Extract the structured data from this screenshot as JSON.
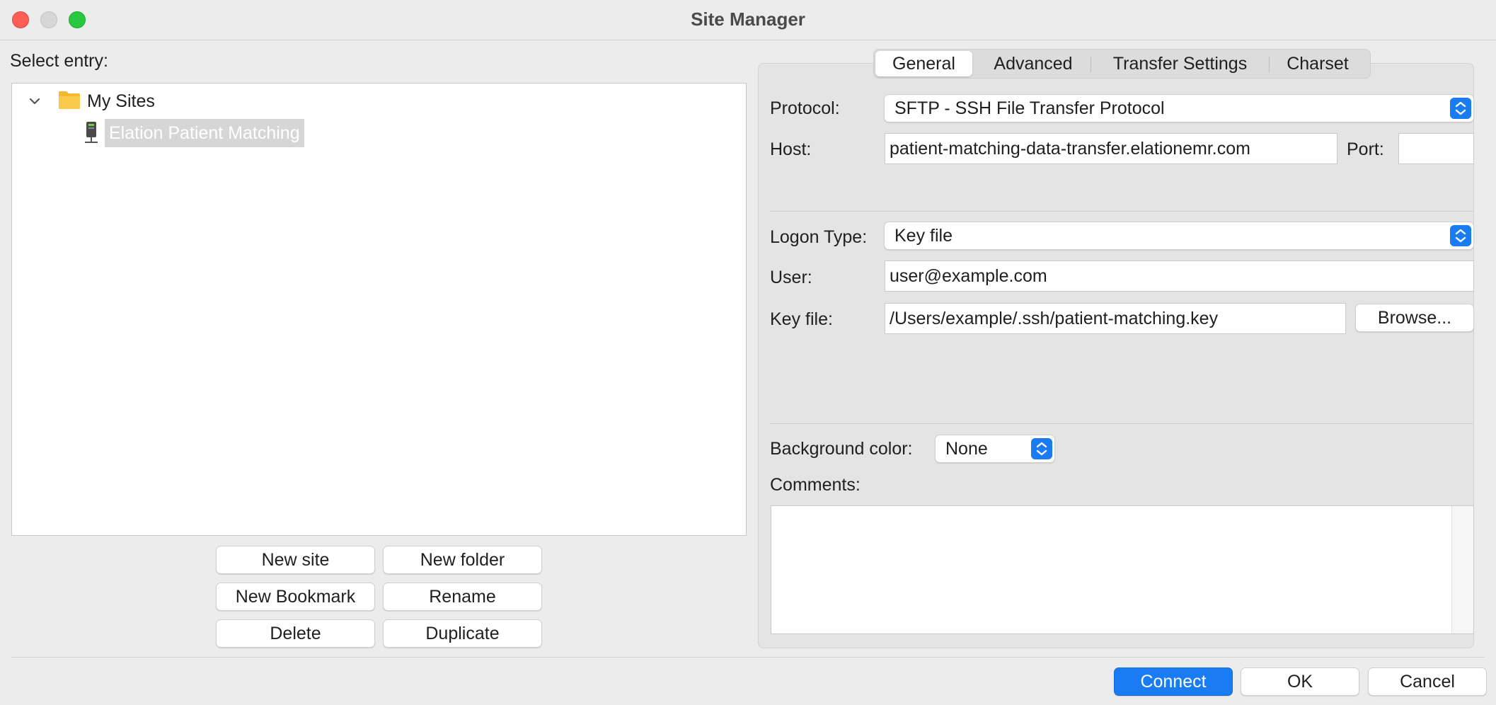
{
  "window": {
    "title": "Site Manager"
  },
  "left": {
    "select_entry_label": "Select entry:",
    "tree": {
      "folder_label": "My Sites",
      "site_label": "Elation Patient Matching"
    },
    "buttons": {
      "new_site": "New site",
      "new_folder": "New folder",
      "new_bookmark": "New Bookmark",
      "rename": "Rename",
      "delete": "Delete",
      "duplicate": "Duplicate"
    }
  },
  "tabs": [
    {
      "label": "General",
      "active": true
    },
    {
      "label": "Advanced",
      "active": false
    },
    {
      "label": "Transfer Settings",
      "active": false
    },
    {
      "label": "Charset",
      "active": false
    }
  ],
  "general": {
    "protocol_label": "Protocol:",
    "protocol_value": "SFTP - SSH File Transfer Protocol",
    "host_label": "Host:",
    "host_value": "patient-matching-data-transfer.elationemr.com",
    "port_label": "Port:",
    "port_value": "",
    "logon_type_label": "Logon Type:",
    "logon_type_value": "Key file",
    "user_label": "User:",
    "user_value": "user@example.com",
    "key_file_label": "Key file:",
    "key_file_value": "/Users/example/.ssh/patient-matching.key",
    "browse_label": "Browse...",
    "background_color_label": "Background color:",
    "background_color_value": "None",
    "comments_label": "Comments:",
    "comments_value": ""
  },
  "footer": {
    "connect": "Connect",
    "ok": "OK",
    "cancel": "Cancel"
  },
  "colors": {
    "accent": "#1a7cf3",
    "close": "#ff5f57",
    "minimize": "#d6d6d6",
    "maximize": "#28c840",
    "folder": "#f5b82e"
  }
}
